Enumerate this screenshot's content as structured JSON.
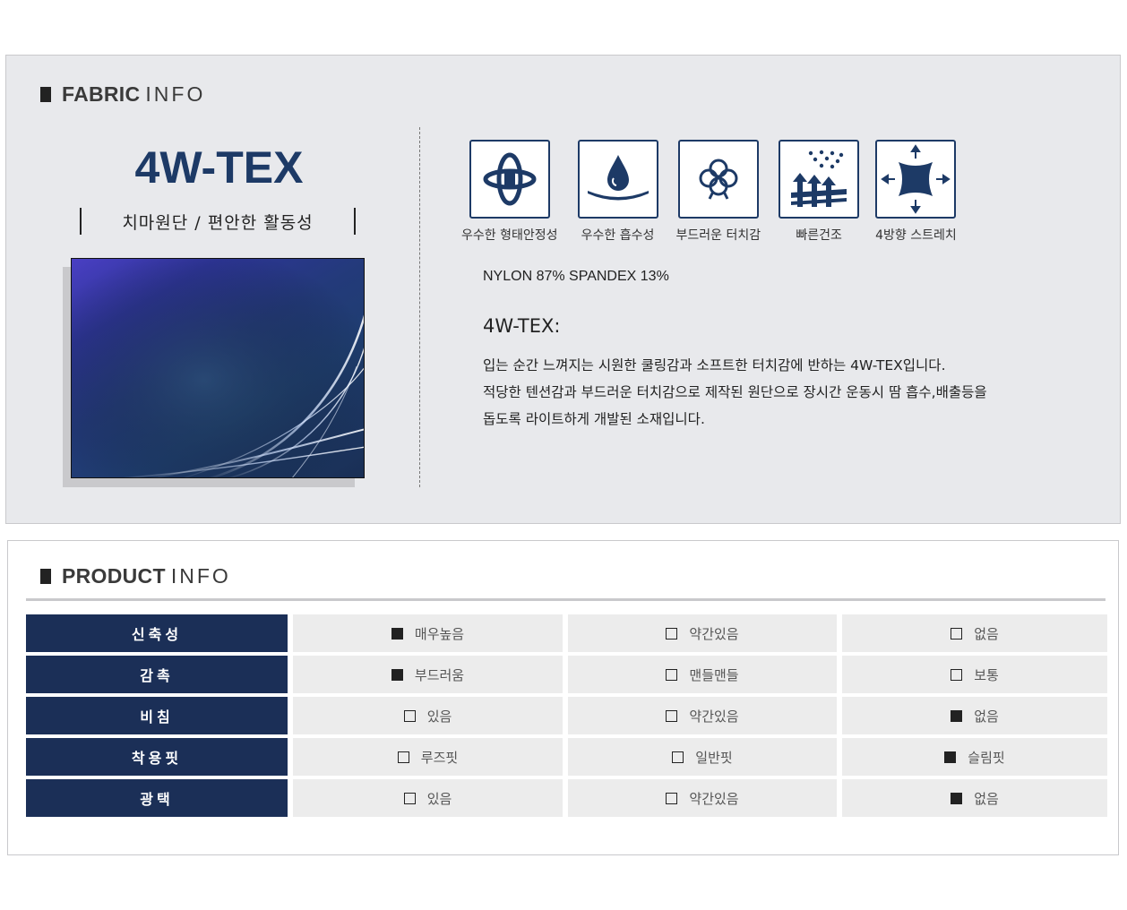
{
  "fabric_info": {
    "title_bold": "FABRIC",
    "title_light": "INFO",
    "name": "4W-TEX",
    "subtitle": "치마원단 / 편안한 활동성",
    "features": [
      {
        "icon": "shape-stability-icon",
        "label": "우수한 형태안정성"
      },
      {
        "icon": "absorption-icon",
        "label": "우수한 흡수성"
      },
      {
        "icon": "cotton-icon",
        "label": "부드러운 터치감"
      },
      {
        "icon": "quick-dry-icon",
        "label": "빠른건조"
      },
      {
        "icon": "stretch-icon",
        "label": "4방향 스트레치"
      }
    ],
    "composition": "NYLON 87% SPANDEX 13%",
    "description_title": "4W-TEX:",
    "description_lines": [
      "입는 순간 느껴지는 시원한 쿨링감과 소프트한 터치감에 반하는 4W-TEX입니다.",
      "적당한 텐션감과 부드러운 터치감으로 제작된 원단으로 장시간 운동시 땀 흡수,배출등을",
      "돕도록 라이트하게 개발된 소재입니다."
    ],
    "accent_color": "#1d3a66"
  },
  "product_info": {
    "title_bold": "PRODUCT",
    "title_light": "INFO",
    "rows": [
      {
        "label": "신축성",
        "options": [
          {
            "text": "매우높음",
            "checked": true
          },
          {
            "text": "약간있음",
            "checked": false
          },
          {
            "text": "없음",
            "checked": false
          }
        ]
      },
      {
        "label": "감촉",
        "options": [
          {
            "text": "부드러움",
            "checked": true
          },
          {
            "text": "맨들맨들",
            "checked": false
          },
          {
            "text": "보통",
            "checked": false
          }
        ]
      },
      {
        "label": "비침",
        "options": [
          {
            "text": "있음",
            "checked": false
          },
          {
            "text": "약간있음",
            "checked": false
          },
          {
            "text": "없음",
            "checked": true
          }
        ]
      },
      {
        "label": "착용핏",
        "options": [
          {
            "text": "루즈핏",
            "checked": false
          },
          {
            "text": "일반핏",
            "checked": false
          },
          {
            "text": "슬림핏",
            "checked": true
          }
        ]
      },
      {
        "label": "광택",
        "options": [
          {
            "text": "있음",
            "checked": false
          },
          {
            "text": "약간있음",
            "checked": false
          },
          {
            "text": "없음",
            "checked": true
          }
        ]
      }
    ],
    "header_color": "#1b2f57"
  }
}
